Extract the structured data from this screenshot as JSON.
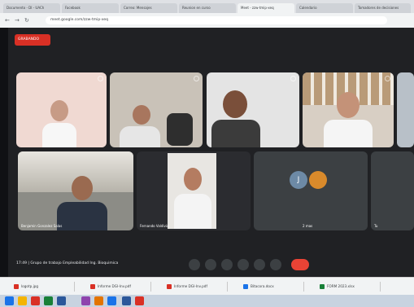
{
  "browser": {
    "tabs": [
      {
        "label": "Documento - DI - UACh"
      },
      {
        "label": "Facebook"
      },
      {
        "label": "Correo: Mensajes"
      },
      {
        "label": "Reunion en curso"
      },
      {
        "label": "Meet - zzw-tmip-xeq",
        "active": true
      },
      {
        "label": "Calendario"
      },
      {
        "label": "Tomadores de decisiones"
      }
    ],
    "address": "meet.google.com/zzw-tmip-xeq"
  },
  "meeting": {
    "recording_label": "GRABANDO",
    "participants": [
      {
        "name": "",
        "type": "video",
        "bg": "#f0d9d2"
      },
      {
        "name": "",
        "type": "video",
        "bg": "#c9c2b8"
      },
      {
        "name": "",
        "type": "video",
        "bg": "#e4e4e4"
      },
      {
        "name": "",
        "type": "video",
        "bg": "#d8cfc4"
      },
      {
        "name": "Benjamin Gonzalez Salas",
        "type": "video",
        "bg": "#8c8c86"
      },
      {
        "name": "Fernando Valdivia",
        "type": "video",
        "bg": "#e8e6e2"
      },
      {
        "name": "2 mas",
        "type": "avatars"
      },
      {
        "name": "Tu",
        "type": "self"
      }
    ],
    "avatar_initial": "J",
    "time": "17:49",
    "meeting_title": "Grupo de trabajo Empleabilidad Ing. Bioquimica"
  },
  "downloads": [
    {
      "label": "logotp.jpg",
      "color": "#d93025"
    },
    {
      "label": "Informe DGI-Inv.pdf",
      "color": "#d93025"
    },
    {
      "label": "Informe DGI-Inv.pdf",
      "color": "#d93025"
    },
    {
      "label": "Bitacora.docx",
      "color": "#1a73e8"
    },
    {
      "label": "FORM 2023.xlsx",
      "color": "#188038"
    }
  ],
  "taskbar_colors": [
    "#1a73e8",
    "#f4b400",
    "#d93025",
    "#188038",
    "#2b579a",
    "#8e44ad",
    "#e37400",
    "#1a73e8",
    "#2b579a",
    "#d93025"
  ]
}
